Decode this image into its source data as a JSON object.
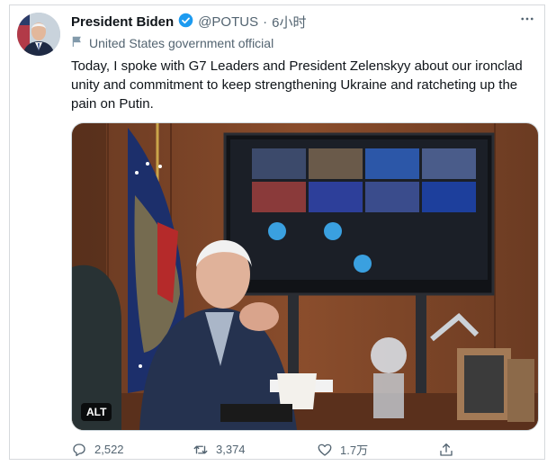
{
  "author": {
    "display_name": "President Biden",
    "handle": "@POTUS",
    "separator": "·",
    "time": "6小时",
    "label": "United States government official"
  },
  "tweet": {
    "text": "Today, I spoke with G7 Leaders and President Zelenskyy about our ironclad unity and commitment to keep strengthening Ukraine and ratcheting up the pain on Putin."
  },
  "media": {
    "alt_badge": "ALT"
  },
  "actions": {
    "reply_count": "2,522",
    "retweet_count": "3,374",
    "like_count": "1.7万"
  },
  "colors": {
    "verified_blue": "#1d9bf0",
    "muted_text": "#536471",
    "label_gray": "#829aab"
  },
  "icons": {
    "more": "more-dots-icon",
    "verified": "verified-badge-icon",
    "government_label": "flag-icon",
    "reply": "reply-icon",
    "retweet": "retweet-icon",
    "like": "heart-icon",
    "share": "share-icon"
  }
}
